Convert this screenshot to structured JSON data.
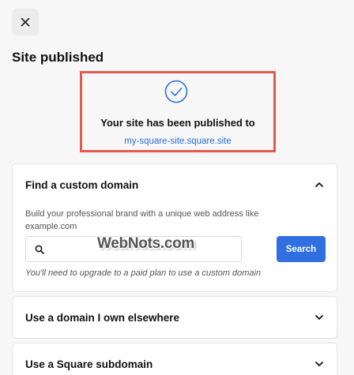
{
  "dialog": {
    "close_icon": "close-icon",
    "title": "Site published"
  },
  "published": {
    "icon": "check-circle-icon",
    "message": "Your site has been published to",
    "site_url": "my-square-site.square.site",
    "highlight_color": "#e05a4f"
  },
  "sections": {
    "custom_domain": {
      "title": "Find a custom domain",
      "expanded": true,
      "description": "Build your professional brand with a unique web address like example.com",
      "search": {
        "placeholder": "",
        "value": "",
        "button_label": "Search"
      },
      "note": "You'll need to upgrade to a paid plan to use a custom domain"
    },
    "own_domain": {
      "title": "Use a domain I own elsewhere",
      "expanded": false
    },
    "square_subdomain": {
      "title": "Use a Square subdomain",
      "expanded": false
    }
  },
  "watermark": "WebNots.com",
  "colors": {
    "accent": "#2f6fe0",
    "link": "#2b6ed6"
  }
}
